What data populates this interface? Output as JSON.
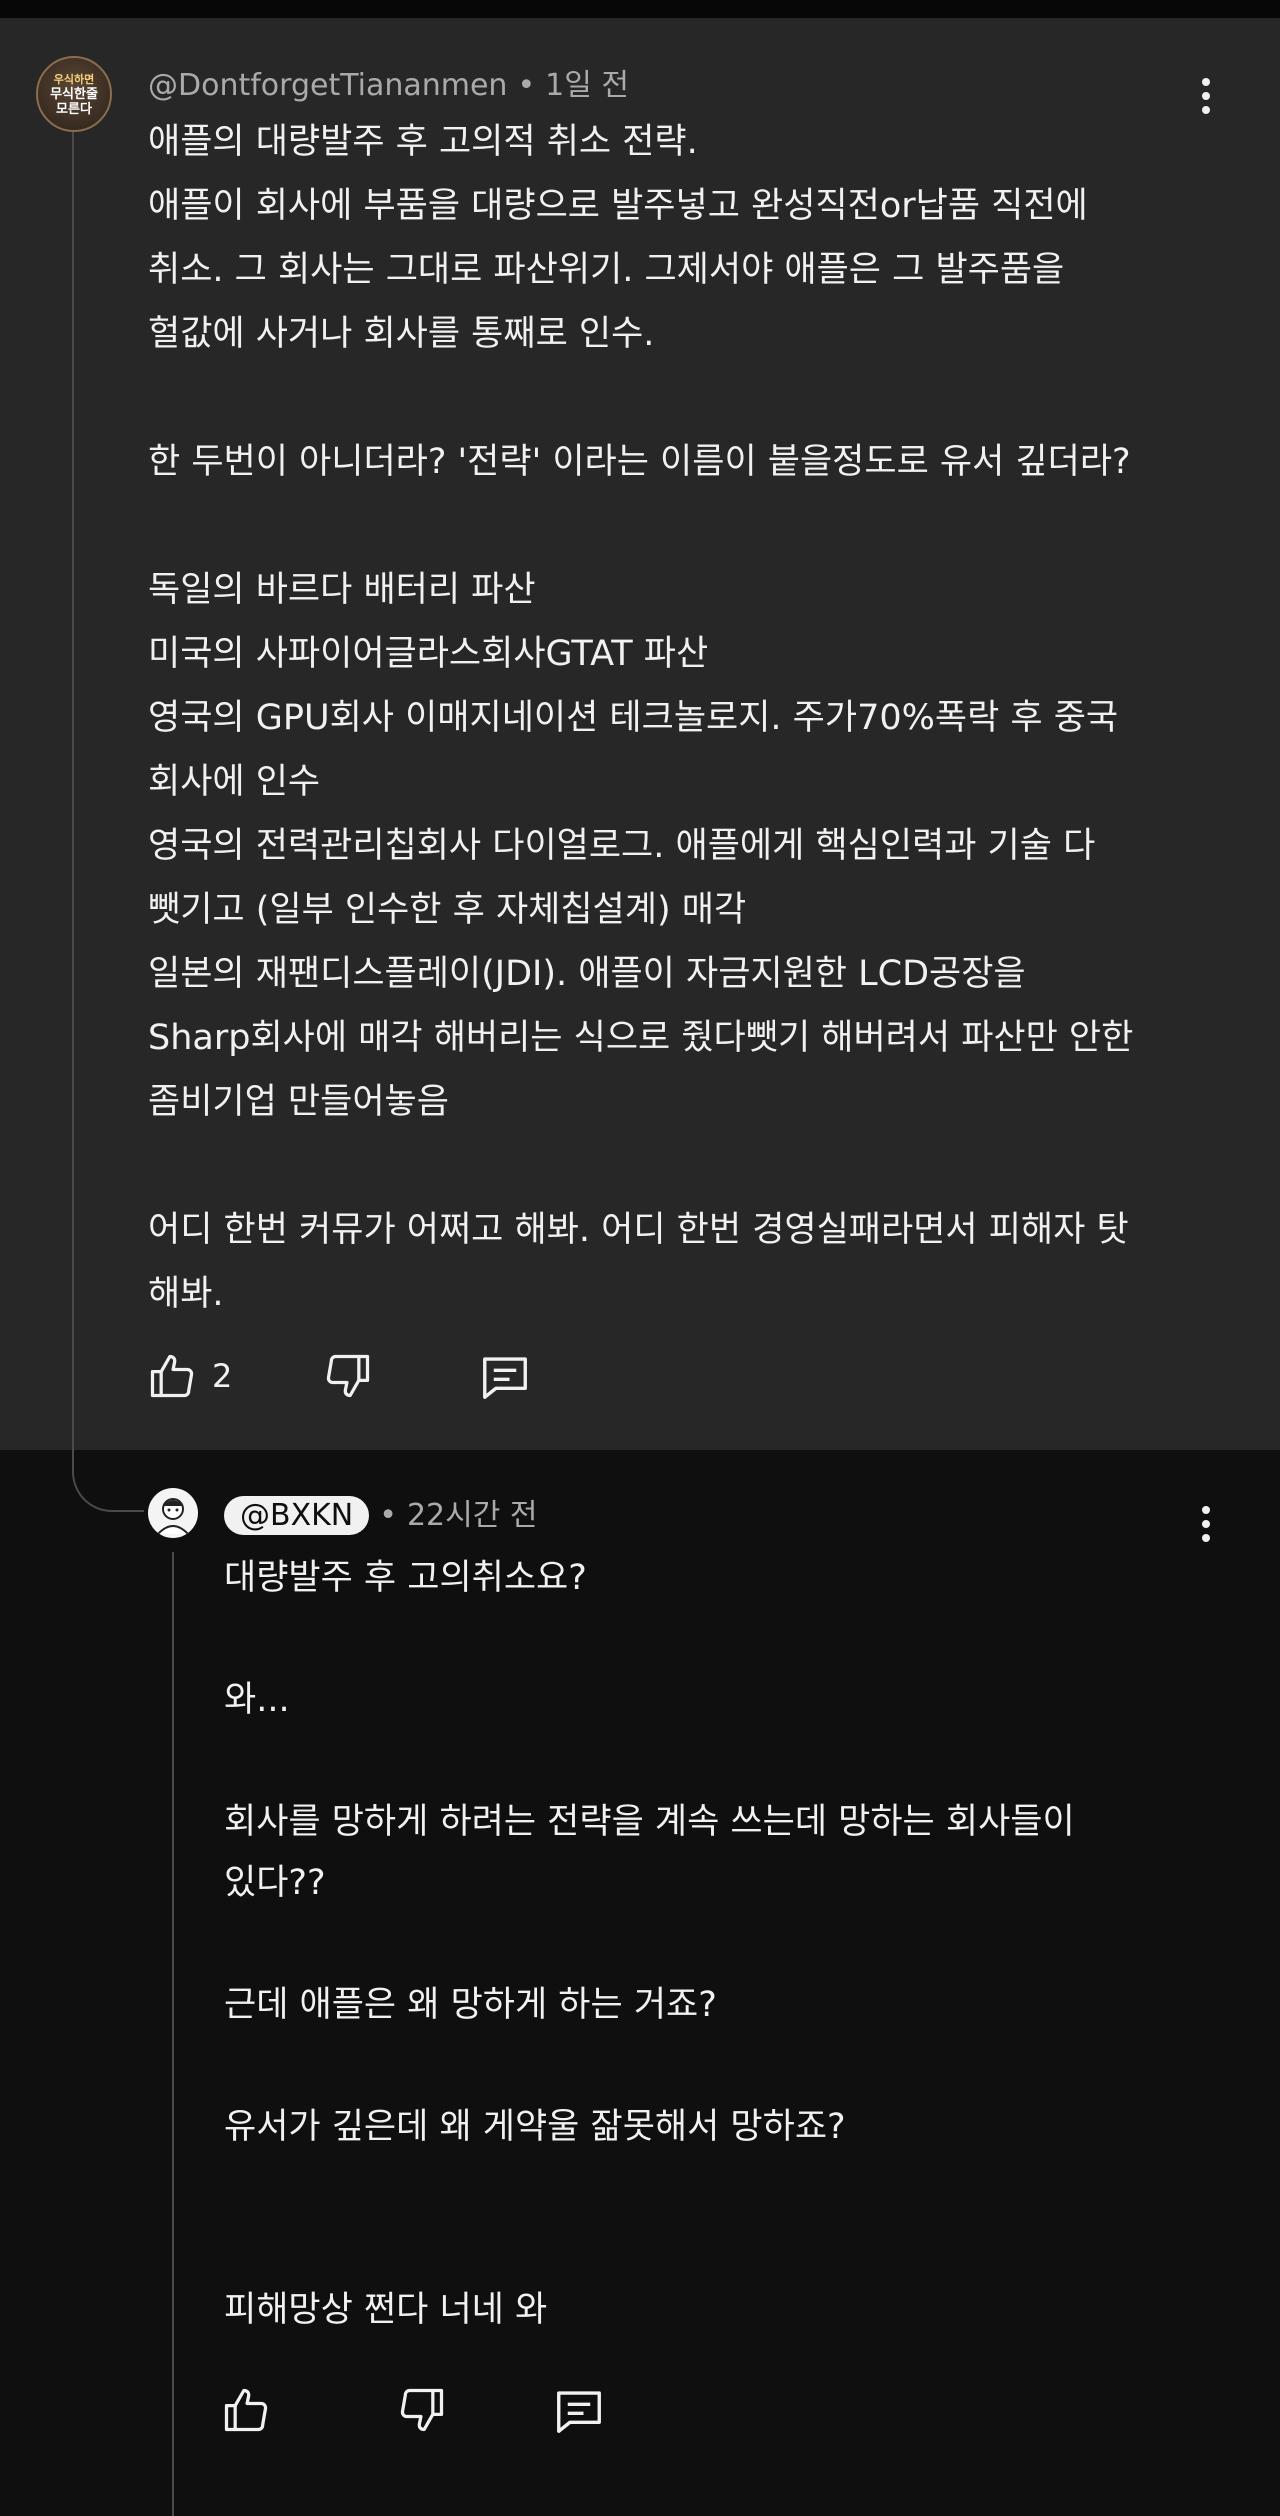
{
  "parent": {
    "avatar_text": [
      "우식하면",
      "무식한줄",
      "모른다"
    ],
    "handle": "@DontforgetTiananmen",
    "time": "1일 전",
    "body": "애플의 대량발주 후 고의적 취소 전략.\n애플이 회사에 부품을 대량으로 발주넣고 완성직전or납품 직전에\n취소. 그 회사는 그대로 파산위기. 그제서야 애플은 그 발주품을\n헐값에 사거나 회사를 통째로 인수.\n\n한 두번이 아니더라? '전략' 이라는 이름이 붙을정도로 유서 깊더라?\n\n독일의 바르다 배터리 파산\n미국의 사파이어글라스회사GTAT 파산\n영국의 GPU회사 이매지네이션 테크놀로지. 주가70%폭락 후 중국\n회사에 인수\n영국의 전력관리칩회사 다이얼로그. 애플에게 핵심인력과 기술 다\n뺏기고 (일부 인수한 후 자체칩설계) 매각\n일본의 재팬디스플레이(JDI). 애플이 자금지원한 LCD공장을\nSharp회사에 매각 해버리는 식으로 줬다뺏기 해버려서 파산만 안한\n좀비기업 만들어놓음\n\n어디 한번 커뮤가 어쩌고 해봐. 어디 한번 경영실패라면서 피해자 탓\n해봐.",
    "like_count": "2",
    "icons": [
      "thumbs-up",
      "thumbs-down",
      "reply"
    ]
  },
  "reply": {
    "handle": "@BXKN",
    "time": "22시간 전",
    "body": "대량발주 후 고의취소요?\n\n와...\n\n회사를 망하게 하려는 전략을 계속 쓰는데 망하는 회사들이\n있다??\n\n근데 애플은 왜 망하게 하는 거죠?\n\n유서가 깊은데 왜 게약울 잚못해서 망하죠?\n\n\n피해망상 쩐다 너네 와",
    "icons": [
      "thumbs-up",
      "thumbs-down",
      "reply"
    ]
  },
  "colors": {
    "background": "#0f0f0f",
    "parent_card": "#272727",
    "text": "#f1f1f1",
    "meta": "#aaaaaa"
  }
}
